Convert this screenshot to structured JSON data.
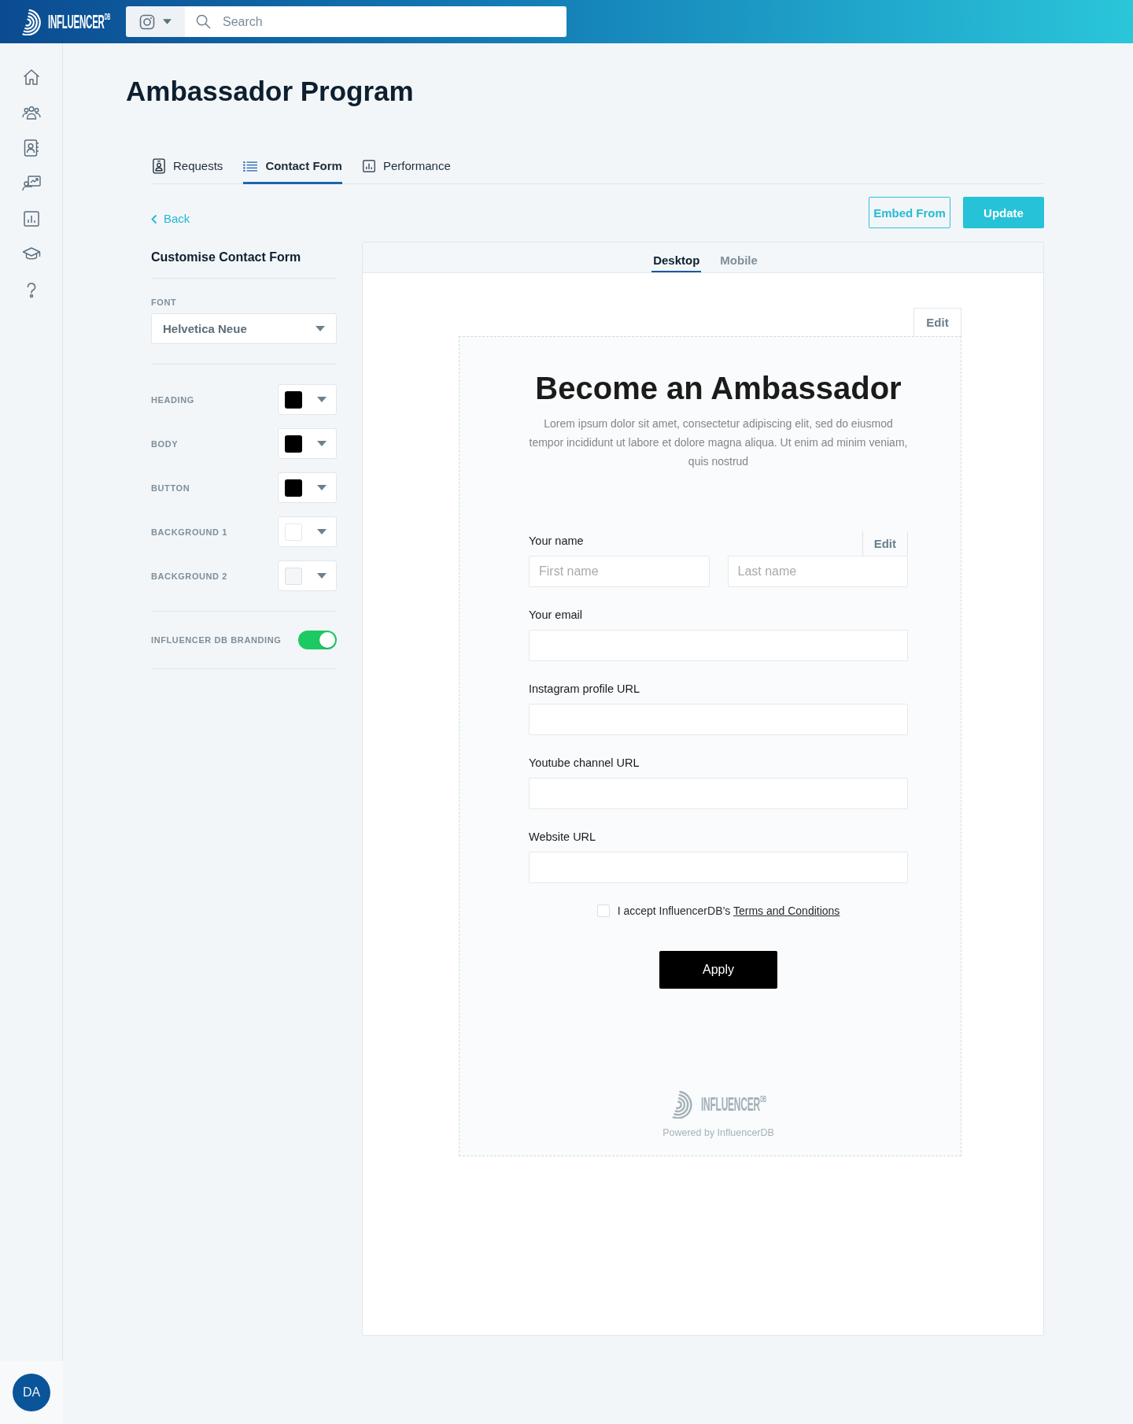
{
  "top_bar": {
    "logo": "INFLUENCER$^{DB}$",
    "search": {
      "placeholder": "Search"
    }
  },
  "user": {
    "initials": "DA"
  },
  "page": {
    "title": "Ambassador Program"
  },
  "tabs": [
    {
      "label": "Requests",
      "selected": false
    },
    {
      "label": "Contact Form",
      "selected": true
    },
    {
      "label": "Performance",
      "selected": false
    }
  ],
  "back_link": {
    "label": "Back"
  },
  "actions": [
    {
      "label": "Embed From",
      "kind": "outline"
    },
    {
      "label": "Update",
      "kind": "primary"
    }
  ],
  "customise_panel": {
    "title": "Customise Contact Form",
    "font": {
      "label": "FONT",
      "value": "Helvetica Neue"
    },
    "colors": [
      {
        "label": "HEADING",
        "color": "#000000"
      },
      {
        "label": "BODY",
        "color": "#000000"
      },
      {
        "label": "BUTTON",
        "color": "#000000"
      },
      {
        "label": "BACKGROUND 1",
        "color": "#ffffff"
      },
      {
        "label": "BACKGROUND 2",
        "color": "#f5f6f7"
      }
    ],
    "branding": {
      "label": "INFLUENCER DB BRANDING",
      "on": true
    }
  },
  "preview": {
    "tabs": [
      {
        "label": "Desktop",
        "selected": true
      },
      {
        "label": "Mobile",
        "selected": false
      }
    ],
    "edit_label": "Edit",
    "form": {
      "heading": "Become an Ambassador",
      "body": "Lorem ipsum dolor sit amet, consectetur adipiscing elit, sed do eiusmod tempor incididunt ut labore et dolore magna aliqua. Ut enim ad minim veniam, quis nostrud",
      "fields": [
        {
          "label": "Your name",
          "kind": "split",
          "edit_label": "Edit",
          "inputs": [
            {
              "placeholder": "First name"
            },
            {
              "placeholder": "Last name"
            }
          ]
        },
        {
          "label": "Your email",
          "kind": "single"
        },
        {
          "label": "Instagram profile URL",
          "kind": "single"
        },
        {
          "label": "Youtube channel URL",
          "kind": "single"
        },
        {
          "label": "Website URL",
          "kind": "single"
        }
      ],
      "consent": {
        "checked": false,
        "text": "I accept InfluencerDB’s",
        "link": "Terms and Conditions"
      },
      "submit": "Apply",
      "footer": {
        "logo": "INFLUENCER$^{DB}$",
        "caption": "Powered by InfluencerDB"
      }
    }
  }
}
